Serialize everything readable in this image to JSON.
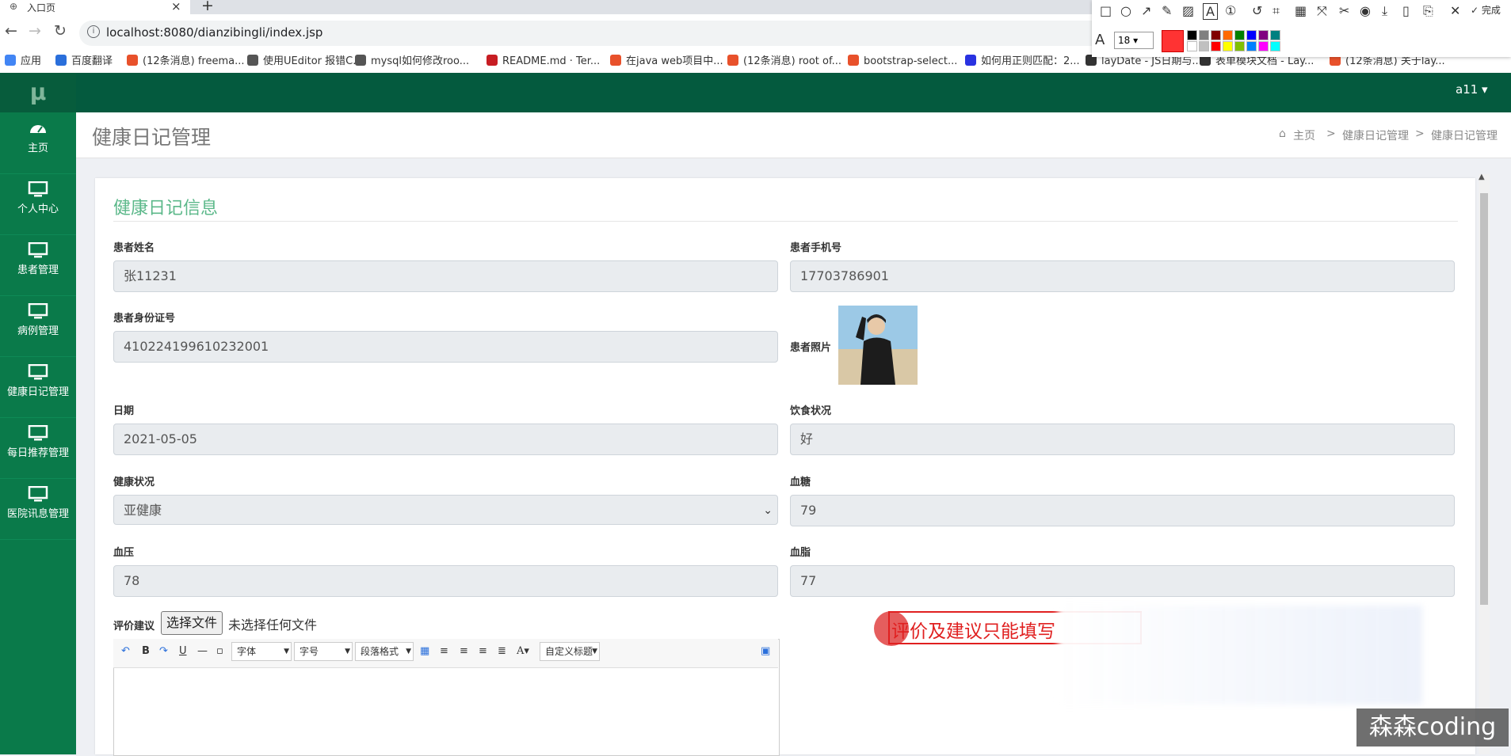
{
  "browser": {
    "tab_title": "入口页",
    "url": "localhost:8080/dianzibingli/index.jsp",
    "bookmarks": [
      {
        "label": "应用",
        "color": "#4285f4"
      },
      {
        "label": "百度翻译",
        "color": "#2a6fdb"
      },
      {
        "label": "(12条消息) freema...",
        "color": "#e8512b"
      },
      {
        "label": "使用UEditor 报错C...",
        "color": "#555555"
      },
      {
        "label": "mysql如何修改roo...",
        "color": "#555555"
      },
      {
        "label": "README.md · Ter...",
        "color": "#c71d23"
      },
      {
        "label": "在java web项目中...",
        "color": "#e8512b"
      },
      {
        "label": "(12条消息) root of...",
        "color": "#e8512b"
      },
      {
        "label": "bootstrap-select...",
        "color": "#e8512b"
      },
      {
        "label": "如何用正则匹配：2...",
        "color": "#2932e1"
      },
      {
        "label": "layDate - JS日期与...",
        "color": "#333333"
      },
      {
        "label": "表单模块文档 - Lay...",
        "color": "#333333"
      },
      {
        "label": "(12条消息) 关于lay...",
        "color": "#e8512b"
      }
    ]
  },
  "screenshot_tool": {
    "font_size": "18",
    "done_label": "完成",
    "current_color": "#ff3333",
    "palette": [
      "#000000",
      "#808080",
      "#800000",
      "#ff6a00",
      "#008000",
      "#0000ff",
      "#800080",
      "#008080",
      "#ffffff",
      "#c0c0c0",
      "#ff0000",
      "#ffff00",
      "#80c000",
      "#0080ff",
      "#ff00ff",
      "#00ffff"
    ]
  },
  "app": {
    "logo": "μ",
    "user": "a11 ▾",
    "sidebar": [
      {
        "label": "主页"
      },
      {
        "label": "个人中心"
      },
      {
        "label": "患者管理"
      },
      {
        "label": "病例管理"
      },
      {
        "label": "健康日记管理"
      },
      {
        "label": "每日推荐管理"
      },
      {
        "label": "医院讯息管理"
      }
    ],
    "page_title": "健康日记管理",
    "breadcrumb": [
      "主页",
      "健康日记管理",
      "健康日记管理"
    ],
    "breadcrumb_sep": ">",
    "home_icon": "home-icon"
  },
  "form": {
    "card_title": "健康日记信息",
    "fields": {
      "name": {
        "label": "患者姓名",
        "value": "张11231"
      },
      "phone": {
        "label": "患者手机号",
        "value": "17703786901"
      },
      "idcard": {
        "label": "患者身份证号",
        "value": "410224199610232001"
      },
      "photo": {
        "label": "患者照片"
      },
      "date": {
        "label": "日期",
        "value": "2021-05-05"
      },
      "diet": {
        "label": "饮食状况",
        "value": "好"
      },
      "health": {
        "label": "健康状况",
        "value": "亚健康"
      },
      "sugar": {
        "label": "血糖",
        "value": "79"
      },
      "pressure": {
        "label": "血压",
        "value": "78"
      },
      "lipid": {
        "label": "血脂",
        "value": "77"
      }
    },
    "advice": {
      "label": "评价建议",
      "file_button": "选择文件",
      "file_status": "未选择任何文件"
    },
    "editor": {
      "font_select": "字体",
      "size_select": "字号",
      "para_select": "段落格式",
      "custom_select": "自定义标题"
    }
  },
  "annotation_text": "评价及建议只能填写",
  "watermark": "森森coding"
}
